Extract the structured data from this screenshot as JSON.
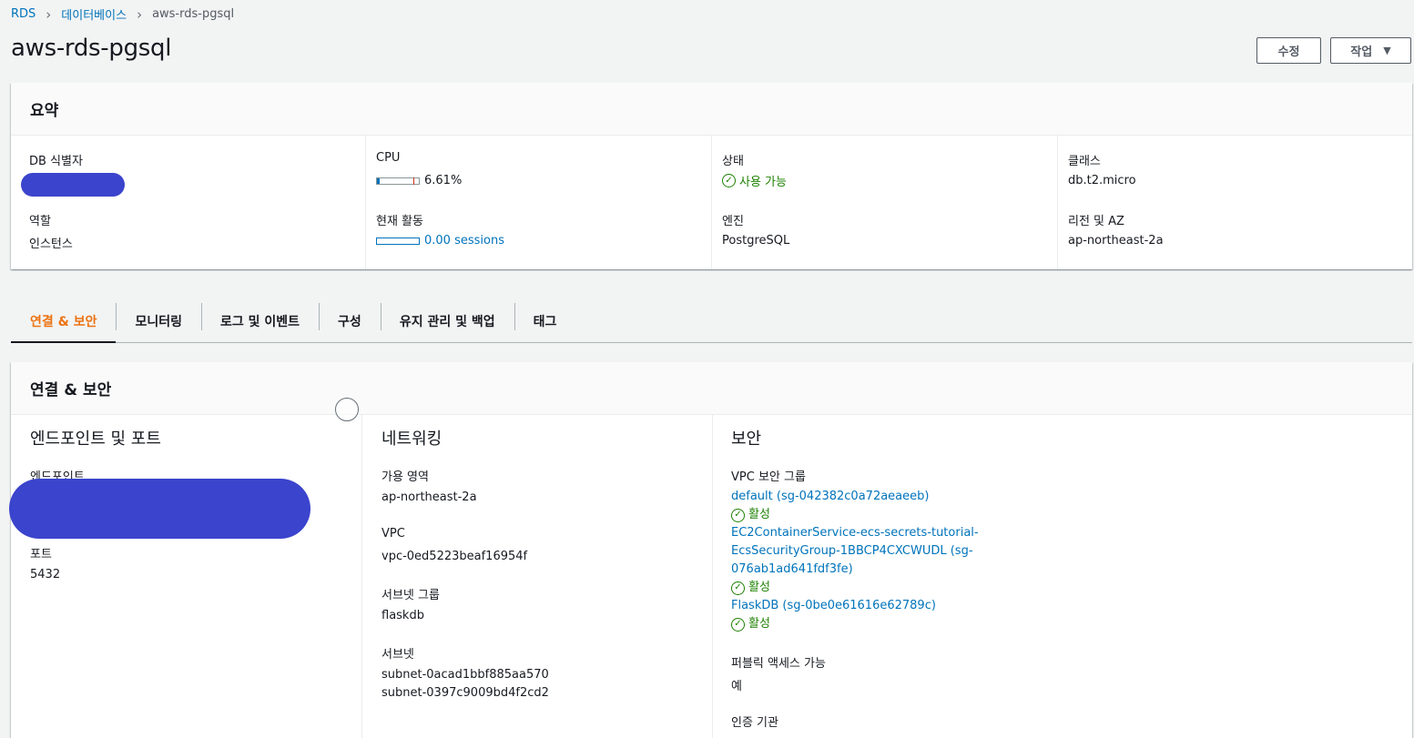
{
  "breadcrumb": [
    {
      "label": "RDS"
    },
    {
      "label": "데이터베이스"
    },
    {
      "label": "aws-rds-pgsql"
    }
  ],
  "page_title": "aws-rds-pgsql",
  "buttons": {
    "modify": "수정",
    "actions": "작업"
  },
  "summary": {
    "title": "요약",
    "db_identifier_label": "DB 식별자",
    "role_label": "역할",
    "role_value": "인스턴스",
    "cpu_label": "CPU",
    "cpu_value": "6.61%",
    "cpu_percent": 6.61,
    "activity_label": "현재 활동",
    "activity_value": "0.00 sessions",
    "status_label": "상태",
    "status_value": "사용 가능",
    "engine_label": "엔진",
    "engine_value": "PostgreSQL",
    "class_label": "클래스",
    "class_value": "db.t2.micro",
    "region_label": "리전 및 AZ",
    "region_value": "ap-northeast-2a"
  },
  "tabs": [
    {
      "label": "연결 & 보안",
      "active": true
    },
    {
      "label": "모니터링"
    },
    {
      "label": "로그 및 이벤트"
    },
    {
      "label": "구성"
    },
    {
      "label": "유지 관리 및 백업"
    },
    {
      "label": "태그"
    }
  ],
  "connectivity": {
    "title": "연결 & 보안",
    "endpoint_section": {
      "title": "엔드포인트 및 포트",
      "endpoint_label": "엔드포인트",
      "port_label": "포트",
      "port_value": "5432"
    },
    "networking": {
      "title": "네트워킹",
      "az_label": "가용 영역",
      "az_value": "ap-northeast-2a",
      "vpc_label": "VPC",
      "vpc_value": "vpc-0ed5223beaf16954f",
      "subnet_group_label": "서브넷 그룹",
      "subnet_group_value": "flaskdb",
      "subnets_label": "서브넷",
      "subnets": [
        "subnet-0acad1bbf885aa570",
        "subnet-0397c9009bd4f2cd2"
      ]
    },
    "security": {
      "title": "보안",
      "sg_label": "VPC 보안 그룹",
      "groups": [
        {
          "lines": [
            "default (sg-042382c0a72aeaeeb)"
          ],
          "status": "활성"
        },
        {
          "lines": [
            "EC2ContainerService-ecs-secrets-tutorial-",
            "EcsSecurityGroup-1BBCP4CXCWUDL (sg-",
            "076ab1ad641fdf3fe)"
          ],
          "status": "활성"
        },
        {
          "lines": [
            "FlaskDB (sg-0be0e61616e62789c)"
          ],
          "status": "활성"
        }
      ],
      "public_label": "퍼블릭 액세스 가능",
      "public_value": "예",
      "ca_label": "인증 기관"
    }
  },
  "colors": {
    "link": "#0073bb",
    "success": "#1d8102",
    "active_tab": "#ec7211",
    "redaction": "#3b44cc"
  }
}
